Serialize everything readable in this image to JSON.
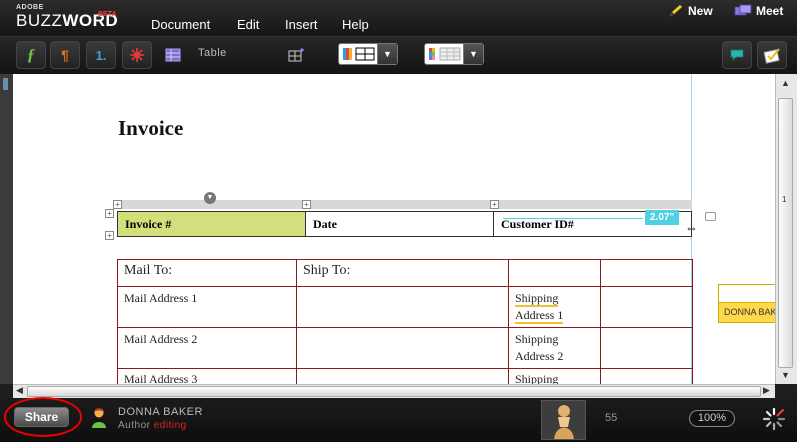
{
  "app": {
    "brand_small": "ADOBE",
    "brand_main_light": "BUZZ",
    "brand_main_bold": "WORD",
    "brand_beta": "BETA"
  },
  "menu": {
    "items": [
      "Document",
      "Edit",
      "Insert",
      "Help"
    ]
  },
  "top_actions": {
    "new_label": "New",
    "meet_label": "Meet"
  },
  "toolbar": {
    "table_label": "Table"
  },
  "document": {
    "title": "Invoice",
    "table1": [
      "Invoice #",
      "Date",
      "Customer ID#"
    ],
    "width_tip": "2.07\"",
    "table2": {
      "header": [
        "Mail To:",
        "Ship To:",
        "",
        ""
      ],
      "rows": [
        [
          "Mail Address 1",
          "",
          "Shipping Address 1",
          ""
        ],
        [
          "Mail Address 2",
          "",
          "Shipping Address 2",
          ""
        ],
        [
          "Mail Address 3",
          "",
          "Shipping",
          ""
        ]
      ]
    },
    "page_indicator": "1"
  },
  "sticky_note": {
    "author": "DONNA BAK"
  },
  "status": {
    "share_label": "Share",
    "user_name": "DONNA BAKER",
    "user_role": "Author",
    "user_state": "editing",
    "page_count": "55",
    "zoom": "100%"
  },
  "colors": {
    "highlight_cell": "#d3df7a",
    "table2_border": "#8b1a1a",
    "cyan_accent": "#4fd0e3",
    "share_circle": "#e00000",
    "sticky_yellow": "#ffd94a"
  }
}
